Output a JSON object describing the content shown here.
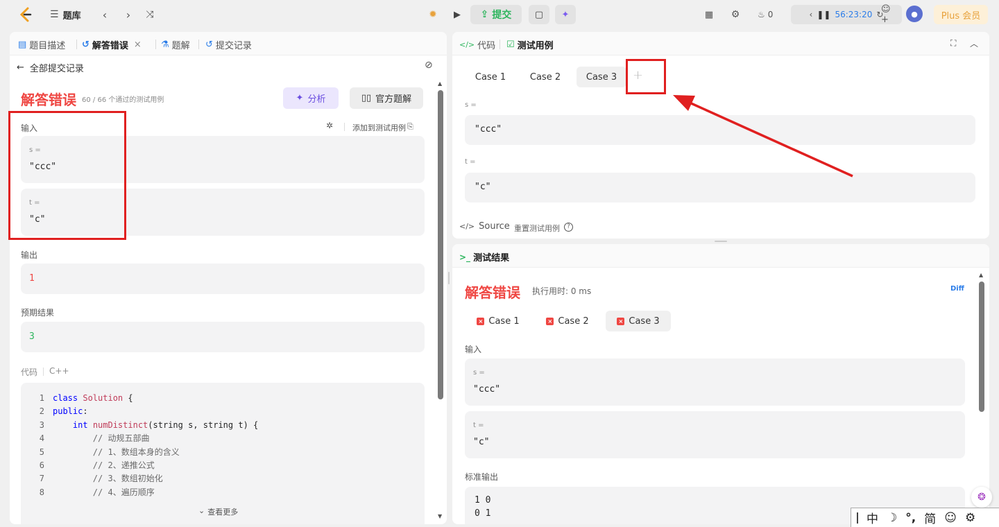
{
  "topbar": {
    "problem_bank": "题库",
    "submit": "提交",
    "streak": "0",
    "timer": "56:23:20",
    "plus": "Plus 会员"
  },
  "left": {
    "tabs": [
      {
        "label": "题目描述"
      },
      {
        "label": "解答错误"
      },
      {
        "label": "题解"
      },
      {
        "label": "提交记录"
      }
    ],
    "back_label": "全部提交记录",
    "status": "解答错误",
    "passed": "60 / 66 个通过的测试用例",
    "analyze": "分析",
    "official": "官方题解",
    "input_label": "输入",
    "add_case": "添加到测试用例",
    "s_var": "s =",
    "s_val": "\"ccc\"",
    "t_var": "t =",
    "t_val": "\"c\"",
    "output_label": "输出",
    "output_val": "1",
    "expected_label": "预期结果",
    "expected_val": "3",
    "code_label": "代码",
    "lang": "C++",
    "code": [
      {
        "n": "1",
        "parts": [
          [
            "kw",
            "class "
          ],
          [
            "cls",
            "Solution"
          ],
          [
            "p",
            " {"
          ]
        ]
      },
      {
        "n": "2",
        "parts": [
          [
            "kw",
            "public"
          ],
          [
            "p",
            ":"
          ]
        ]
      },
      {
        "n": "3",
        "parts": [
          [
            "p",
            "    "
          ],
          [
            "ty",
            "int "
          ],
          [
            "fn",
            "numDistinct"
          ],
          [
            "p",
            "(string s, string t) {"
          ]
        ]
      },
      {
        "n": "4",
        "parts": [
          [
            "cm",
            "        // 动规五部曲"
          ]
        ]
      },
      {
        "n": "5",
        "parts": [
          [
            "cm",
            "        // 1、数组本身的含义"
          ]
        ]
      },
      {
        "n": "6",
        "parts": [
          [
            "cm",
            "        // 2、递推公式"
          ]
        ]
      },
      {
        "n": "7",
        "parts": [
          [
            "cm",
            "        // 3、数组初始化"
          ]
        ]
      },
      {
        "n": "8",
        "parts": [
          [
            "cm",
            "        // 4、遍历顺序"
          ]
        ]
      }
    ],
    "see_more": "查看更多"
  },
  "testcase": {
    "tab_code": "代码",
    "tab_testcase": "测试用例",
    "cases": [
      "Case 1",
      "Case 2",
      "Case 3"
    ],
    "s_var": "s =",
    "s_val": "\"ccc\"",
    "t_var": "t =",
    "t_val": "\"c\"",
    "source": "Source",
    "reset": "重置测试用例"
  },
  "result": {
    "title": "测试结果",
    "status": "解答错误",
    "runtime": "执行用时: 0 ms",
    "diff": "Diff",
    "cases": [
      "Case 1",
      "Case 2",
      "Case 3"
    ],
    "input_label": "输入",
    "s_var": "s =",
    "s_val": "\"ccc\"",
    "t_var": "t =",
    "t_val": "\"c\"",
    "stdout_label": "标准输出",
    "stdout_lines": [
      "1 0",
      "0 1"
    ]
  },
  "ime": {
    "chars": [
      "中",
      "简"
    ]
  },
  "colors": {
    "error": "#ef4743",
    "success": "#2db55d",
    "annotation": "#e02020",
    "accent": "#2b7de9"
  }
}
